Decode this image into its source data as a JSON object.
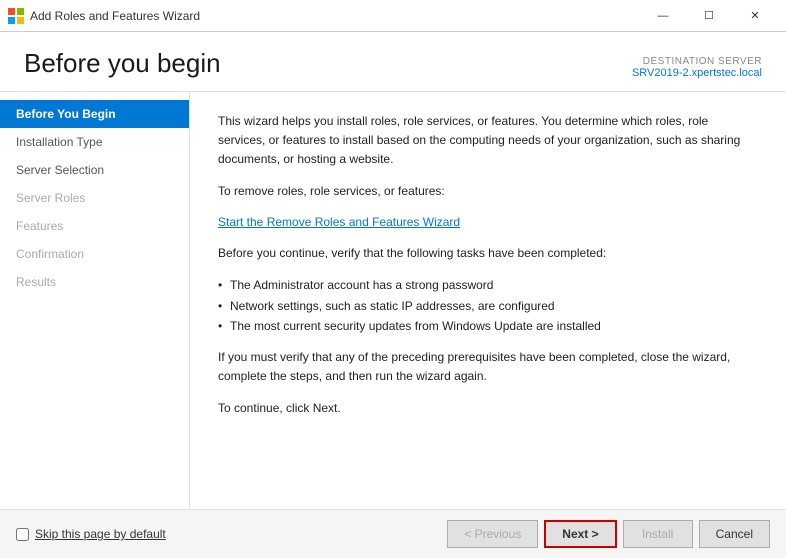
{
  "titleBar": {
    "title": "Add Roles and Features Wizard",
    "iconColor": "#0078d4",
    "controls": {
      "minimize": "—",
      "maximize": "☐",
      "close": "✕"
    }
  },
  "header": {
    "title": "Before you begin",
    "destinationLabel": "DESTINATION SERVER",
    "serverName": "SRV2019-2.xpertstec.local"
  },
  "sidebar": {
    "items": [
      {
        "label": "Before You Begin",
        "state": "active"
      },
      {
        "label": "Installation Type",
        "state": "normal"
      },
      {
        "label": "Server Selection",
        "state": "normal"
      },
      {
        "label": "Server Roles",
        "state": "disabled"
      },
      {
        "label": "Features",
        "state": "disabled"
      },
      {
        "label": "Confirmation",
        "state": "disabled"
      },
      {
        "label": "Results",
        "state": "disabled"
      }
    ]
  },
  "content": {
    "paragraph1": "This wizard helps you install roles, role services, or features. You determine which roles, role services, or features to install based on the computing needs of your organization, such as sharing documents, or hosting a website.",
    "removeLabel": "To remove roles, role services, or features:",
    "removeLink": "Start the Remove Roles and Features Wizard",
    "paragraph2": "Before you continue, verify that the following tasks have been completed:",
    "bullets": [
      "The Administrator account has a strong password",
      "Network settings, such as static IP addresses, are configured",
      "The most current security updates from Windows Update are installed"
    ],
    "paragraph3": "If you must verify that any of the preceding prerequisites have been completed, close the wizard, complete the steps, and then run the wizard again.",
    "paragraph4": "To continue, click Next."
  },
  "footer": {
    "checkboxLabel": "Skip this page by default",
    "buttons": {
      "previous": "< Previous",
      "next": "Next >",
      "install": "Install",
      "cancel": "Cancel"
    }
  }
}
